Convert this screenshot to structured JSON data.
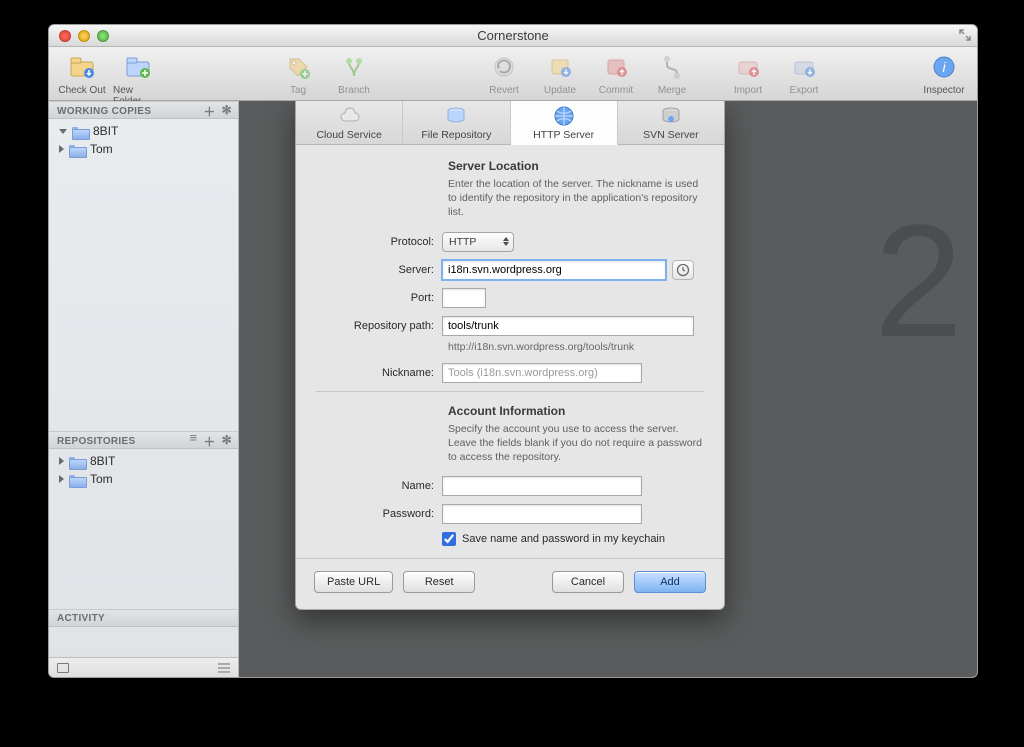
{
  "title": "Cornerstone",
  "toolbar": {
    "checkout": "Check Out",
    "newfolder": "New Folder",
    "tag": "Tag",
    "branch": "Branch",
    "revert": "Revert",
    "update": "Update",
    "commit": "Commit",
    "merge": "Merge",
    "import": "Import",
    "export": "Export",
    "inspector": "Inspector"
  },
  "sidebar": {
    "working_copies": {
      "header": "WORKING COPIES",
      "items": [
        "8BIT",
        "Tom"
      ]
    },
    "repositories": {
      "header": "REPOSITORIES",
      "items": [
        "8BIT",
        "Tom"
      ]
    },
    "activity": {
      "header": "ACTIVITY"
    }
  },
  "sheet": {
    "tabs": {
      "cloud": "Cloud Service",
      "file": "File Repository",
      "http": "HTTP Server",
      "svn": "SVN Server"
    },
    "location": {
      "title": "Server Location",
      "desc": "Enter the location of the server. The nickname is used to identify the repository in the application's repository list.",
      "protocol_label": "Protocol:",
      "protocol_value": "HTTP",
      "server_label": "Server:",
      "server_value": "i18n.svn.wordpress.org",
      "port_label": "Port:",
      "port_value": "",
      "path_label": "Repository path:",
      "path_value": "tools/trunk",
      "url_preview": "http://i18n.svn.wordpress.org/tools/trunk",
      "nick_label": "Nickname:",
      "nick_value": "Tools (i18n.svn.wordpress.org)"
    },
    "account": {
      "title": "Account Information",
      "desc": "Specify the account you use to access the server. Leave the fields blank if you do not require a password to access the repository.",
      "name_label": "Name:",
      "pass_label": "Password:",
      "keychain": "Save name and password in my keychain"
    },
    "buttons": {
      "paste": "Paste URL",
      "reset": "Reset",
      "cancel": "Cancel",
      "add": "Add"
    }
  },
  "watermark": "2"
}
